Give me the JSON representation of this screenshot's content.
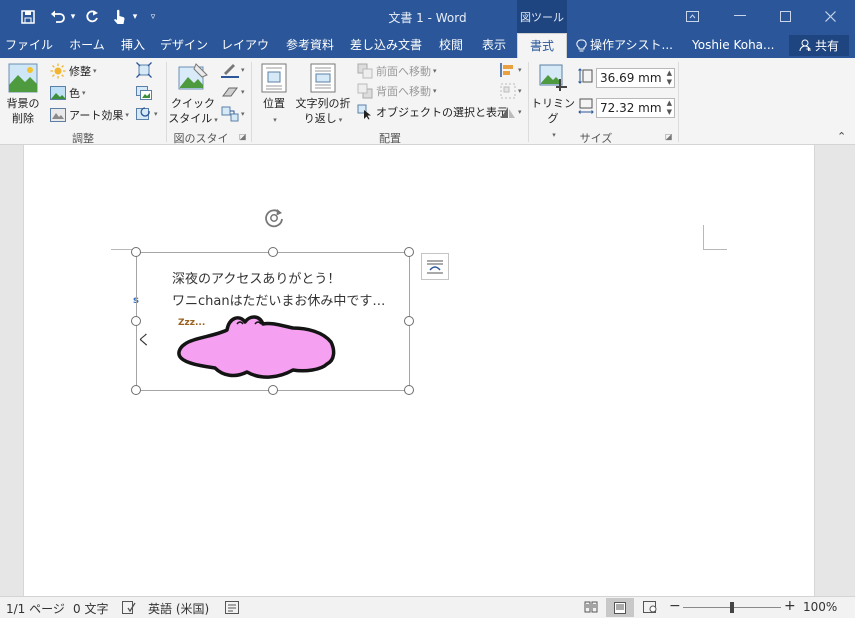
{
  "window": {
    "title": "文書 1 - Word",
    "context_tab_label": "図ツール",
    "accent_color": "#2b579a"
  },
  "quick_access": {
    "save_icon": "save-icon",
    "undo_icon": "undo-icon",
    "redo_icon": "redo-icon",
    "touch_mode_icon": "touch-mode-icon",
    "customize_icon": "customize-icon"
  },
  "tabs": [
    {
      "label": "ファイル"
    },
    {
      "label": "ホーム"
    },
    {
      "label": "挿入"
    },
    {
      "label": "デザイン"
    },
    {
      "label": "レイアウト"
    },
    {
      "label": "参考資料"
    },
    {
      "label": "差し込み文書"
    },
    {
      "label": "校閲"
    },
    {
      "label": "表示"
    },
    {
      "label": "書式"
    }
  ],
  "active_tab": "書式",
  "tell_me": {
    "label": "操作アシスト..."
  },
  "user": {
    "name": "Yoshie Koha..."
  },
  "share": {
    "label": "共有"
  },
  "ribbon": {
    "adjust": {
      "group_label": "調整",
      "remove_background": {
        "line1": "背景の",
        "line2": "削除"
      },
      "corrections": "修整",
      "color": "色",
      "artistic_effects": "アート効果"
    },
    "picture_styles": {
      "group_label": "図のスタイル",
      "quick_styles": {
        "line1": "クイック",
        "line2": "スタイル"
      }
    },
    "arrange": {
      "group_label": "配置",
      "position": "位置",
      "wrap_text": {
        "line1": "文字列の折",
        "line2": "り返し"
      },
      "bring_forward": "前面へ移動",
      "send_backward": "背面へ移動",
      "selection_pane": "オブジェクトの選択と表示"
    },
    "size": {
      "group_label": "サイズ",
      "crop": "トリミング",
      "height_value": "36.69 mm",
      "width_value": "72.32 mm"
    }
  },
  "document": {
    "image_line1": "深夜のアクセスありがとう！",
    "image_line2": "ワニchanはただいまお休み中です…",
    "zzz": "Zzz...",
    "side_char": "く",
    "blob_color": "#f5a0f0"
  },
  "status": {
    "page": "1/1 ページ",
    "words": "0 文字",
    "language": "英語 (米国)",
    "zoom_percent": "100%",
    "zoom_level": 0.5
  }
}
